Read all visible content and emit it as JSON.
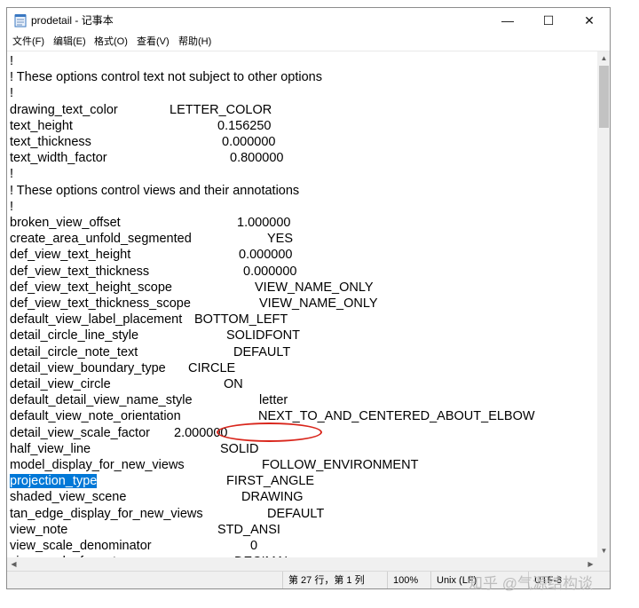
{
  "window": {
    "title": "prodetail - 记事本",
    "min_glyph": "—",
    "max_glyph": "☐",
    "close_glyph": "✕"
  },
  "menu": {
    "file": "文件(F)",
    "edit": "编辑(E)",
    "format": "格式(O)",
    "view": "查看(V)",
    "help": "帮助(H)"
  },
  "lines": [
    {
      "text": "!",
      "value": ""
    },
    {
      "text": "! These options control text not subject to other options",
      "value": ""
    },
    {
      "text": "!",
      "value": ""
    },
    {
      "text": "drawing_text_color",
      "value": "LETTER_COLOR"
    },
    {
      "text": "text_height",
      "value": "0.156250"
    },
    {
      "text": "text_thickness",
      "value": "0.000000"
    },
    {
      "text": "text_width_factor",
      "value": "0.800000"
    },
    {
      "text": "!",
      "value": ""
    },
    {
      "text": "! These options control views and their annotations",
      "value": ""
    },
    {
      "text": "!",
      "value": ""
    },
    {
      "text": "broken_view_offset",
      "value": "1.000000"
    },
    {
      "text": "create_area_unfold_segmented",
      "value": "YES"
    },
    {
      "text": "def_view_text_height",
      "value": "0.000000"
    },
    {
      "text": "def_view_text_thickness",
      "value": "0.000000"
    },
    {
      "text": "def_view_text_height_scope",
      "value": "VIEW_NAME_ONLY"
    },
    {
      "text": "def_view_text_thickness_scope",
      "value": "VIEW_NAME_ONLY"
    },
    {
      "text": "default_view_label_placement",
      "value": "BOTTOM_LEFT"
    },
    {
      "text": "detail_circle_line_style",
      "value": "SOLIDFONT"
    },
    {
      "text": "detail_circle_note_text",
      "value": "DEFAULT"
    },
    {
      "text": "detail_view_boundary_type",
      "value": "CIRCLE"
    },
    {
      "text": "detail_view_circle",
      "value": "ON"
    },
    {
      "text": "default_detail_view_name_style",
      "value": "letter"
    },
    {
      "text": "default_view_note_orientation",
      "value": "NEXT_TO_AND_CENTERED_ABOUT_ELBOW"
    },
    {
      "text": "detail_view_scale_factor",
      "value": "2.000000"
    },
    {
      "text": "half_view_line",
      "value": "SOLID"
    },
    {
      "text": "model_display_for_new_views",
      "value": "FOLLOW_ENVIRONMENT"
    },
    {
      "text": "projection_type",
      "value": "FIRST_ANGLE"
    },
    {
      "text": "shaded_view_scene",
      "value": "DRAWING"
    },
    {
      "text": "tan_edge_display_for_new_views",
      "value": "DEFAULT"
    },
    {
      "text": "view_note",
      "value": "STD_ANSI"
    },
    {
      "text": "view_scale_denominator",
      "value": "0"
    },
    {
      "text": "view_scale_format",
      "value": "DECIMAL"
    }
  ],
  "selected_line": 26,
  "status": {
    "position": "第 27 行，第 1 列",
    "zoom": "100%",
    "eol": "Unix (LF)",
    "encoding": "UTF-8"
  },
  "watermark": "知乎 @气源结构谈",
  "colors": {
    "selection": "#0078d7",
    "highlight_ellipse": "#d9261c"
  }
}
